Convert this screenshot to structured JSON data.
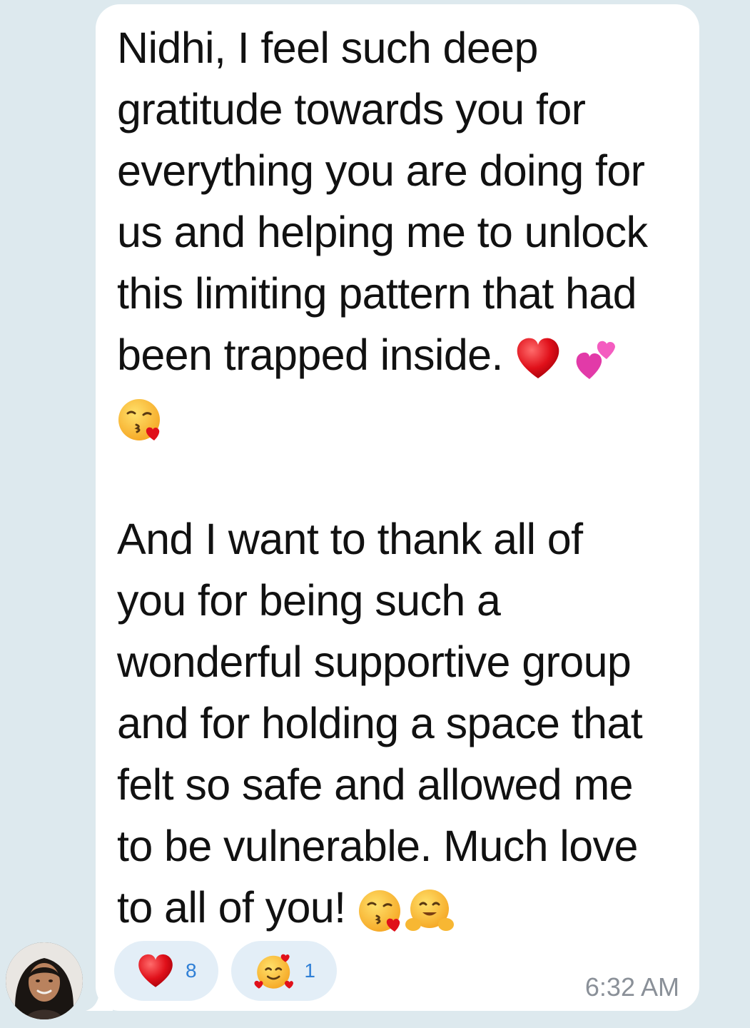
{
  "message": {
    "paragraph1_line1": "Nidhi, I feel such deep",
    "paragraph1_line2": "gratitude towards you for",
    "paragraph1_line3": "everything you are doing for",
    "paragraph1_line4": "us and helping me to unlock",
    "paragraph1_line5": "this limiting pattern that had",
    "paragraph1_line6": "been trapped inside.",
    "paragraph2_line1": "And I want to thank all of",
    "paragraph2_line2": "you for being such a",
    "paragraph2_line3": "wonderful supportive group",
    "paragraph2_line4": "and for holding a space that",
    "paragraph2_line5": "felt so safe and allowed me",
    "paragraph2_line6": "to be vulnerable. Much love",
    "paragraph2_line7": "to all of you!",
    "timestamp": "6:32 AM"
  },
  "reactions": [
    {
      "icon": "red-heart-icon",
      "count": "8"
    },
    {
      "icon": "smiling-face-with-hearts-icon",
      "count": "1"
    }
  ],
  "colors": {
    "chat_background": "#dde9ee",
    "bubble": "#ffffff",
    "reaction_pill": "#e3eef7",
    "reaction_count": "#2f7fd6",
    "timestamp": "#8a9098"
  }
}
